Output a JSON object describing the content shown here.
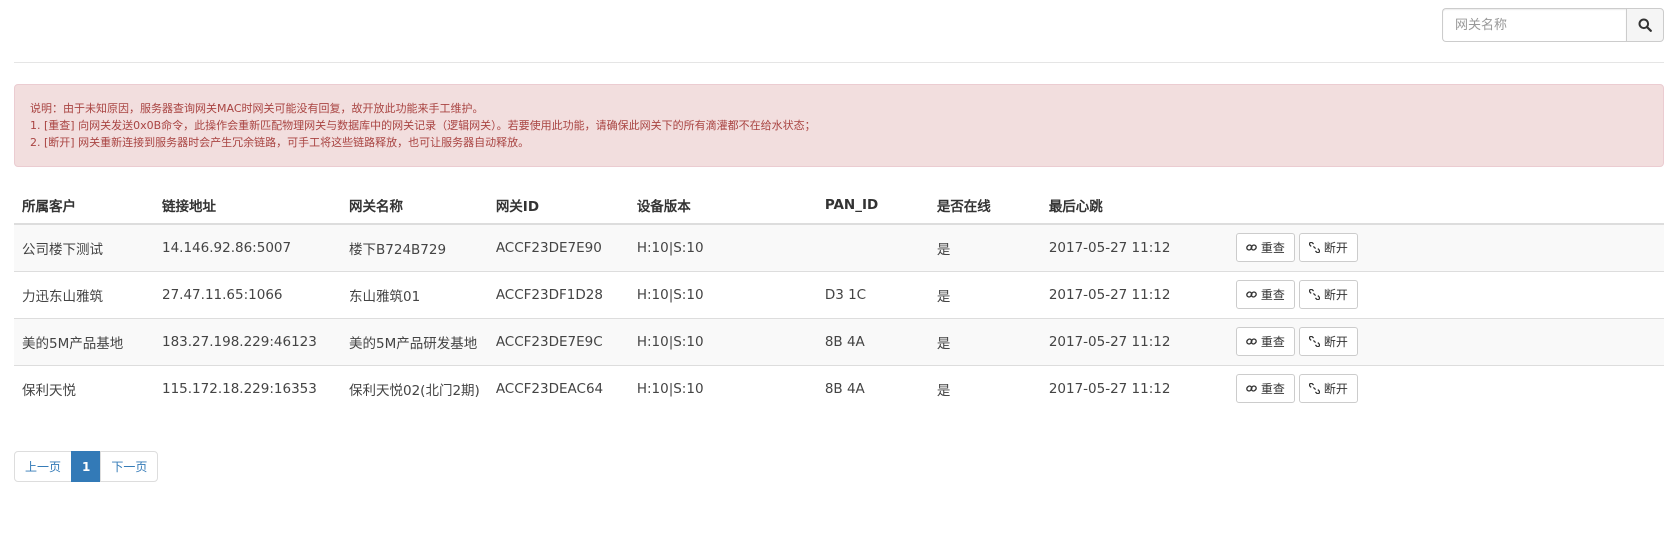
{
  "search": {
    "placeholder": "网关名称",
    "icon": "search-icon"
  },
  "notice": {
    "lines": [
      "说明：由于未知原因，服务器查询网关MAC时网关可能没有回复，故开放此功能来手工维护。",
      "1. [重查] 向网关发送0x0B命令，此操作会重新匹配物理网关与数据库中的网关记录（逻辑网关）。若要使用此功能，请确保此网关下的所有滴灌都不在给水状态；",
      "2. [断开] 网关重新连接到服务器时会产生冗余链路，可手工将这些链路释放，也可让服务器自动释放。"
    ],
    "colors": {
      "background": "#f2dede",
      "text": "#a94442"
    }
  },
  "table": {
    "headers": [
      "所属客户",
      "链接地址",
      "网关名称",
      "网关ID",
      "设备版本",
      "PAN_ID",
      "是否在线",
      "最后心跳",
      ""
    ],
    "rows": [
      [
        "公司楼下测试",
        "14.146.92.86:5007",
        "楼下B724B729",
        "ACCF23DE7E90",
        "H:10|S:10",
        "",
        "是",
        "2017-05-27 11:12"
      ],
      [
        "力迅东山雅筑",
        "27.47.11.65:1066",
        "东山雅筑01",
        "ACCF23DF1D28",
        "H:10|S:10",
        "D3 1C",
        "是",
        "2017-05-27 11:12"
      ],
      [
        "美的5M产品基地",
        "183.27.198.229:46123",
        "美的5M产品研发基地",
        "ACCF23DE7E9C",
        "H:10|S:10",
        "8B 4A",
        "是",
        "2017-05-27 11:12"
      ],
      [
        "保利天悦",
        "115.172.18.229:16353",
        "保利天悦02(北门2期)",
        "ACCF23DEAC64",
        "H:10|S:10",
        "8B 4A",
        "是",
        "2017-05-27 11:12"
      ]
    ],
    "actions": {
      "recheck_label": "重查",
      "recheck_icon": "link-icon",
      "disconnect_label": "断开",
      "disconnect_icon": "unlink-icon"
    }
  },
  "pagination": {
    "prev": "上一页",
    "current": "1",
    "next": "下一页",
    "accent": "#337ab7"
  }
}
